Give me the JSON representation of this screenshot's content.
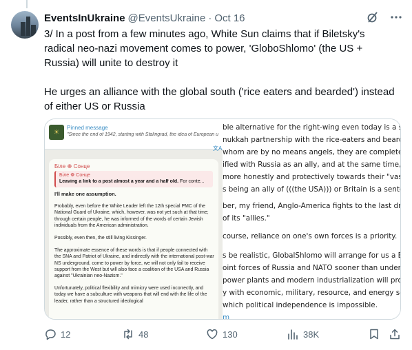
{
  "tweet": {
    "display_name": "EventsInUkraine",
    "handle": "@EventsUkraine",
    "separator": "·",
    "date": "Oct 16",
    "paragraphs": [
      "3/ In a post from a few minutes ago, White Sun claims that if Biletsky's radical neo-nazi movement comes to power, 'GloboShlomo' (the US + Russia) will unite to destroy it",
      "He urges an alliance with the global south ('rice eaters and bearded') instead of either US or Russia"
    ]
  },
  "media": {
    "left": {
      "pinned_title": "Pinned message",
      "pinned_text": "\"Since the end of 1942, starting with Stalingrad, the idea of European u",
      "translate_glyph": "文A",
      "channel_name": "Біле ☸ Сонце",
      "reply_name": "Біле ☸ Сонце",
      "reply_text_bold": "Leaving a link to a post almost a year and a half old.",
      "reply_text": " For conte...",
      "paragraphs": [
        "I'll make one assumption.",
        "Probably, even before the White Leader left the 12th special PMC of the National Guard of Ukraine, which, however, was not yet such at that time; through certain people, he was informed of the words of certain Jewish individuals from the American administration.",
        "Possibly, even then, the still living Kissinger.",
        "The approximate essence of these words is that if people connected with the SNA and Patriot of Ukraine, and indirectly with the international post-war NS underground, come to power by force, we will not only fail to receive support from the West but will also face a coalition of the USA and Russia against \"Ukrainian neo-Nazism.\"",
        "Unfortunately, political flexibility and mimicry were used incorrectly, and today we have a subculture with weapons that will end with the life of the leader, rather than a structured ideological"
      ]
    },
    "right": {
      "lines": [
        "ble alternative for the right-wing even today is a situa",
        "nukkah partnership with the rice-eaters and bearded",
        " whom are by no means angels, they are completely",
        "ified with Russia as an ally, and at the same time, they",
        " more honestly and protectively towards their \"vassa",
        "s being an ally of (((the USA))) or Britain is a sentence",
        "",
        "ber, my friend, Anglo-America fights to the last drop",
        " of its \"allies.\"",
        "",
        "course, reliance on one's own forces is a priority.",
        "",
        "s be realistic, GlobalShlomo will arrange for us a Belgi",
        "oint forces of Russia and NATO sooner than undergro",
        " power plants and modern industrialization will provi",
        "y with economic, military, resource, and energy sover",
        " which political independence is impossible.",
        "",
        "m"
      ]
    }
  },
  "actions": {
    "replies": "12",
    "reposts": "48",
    "likes": "130",
    "views": "38K"
  },
  "colors": {
    "text": "#0f1419",
    "muted": "#536471",
    "border": "#cfd9de",
    "telegram_link": "#3a8dc4",
    "channel_red": "#d04a4a"
  }
}
